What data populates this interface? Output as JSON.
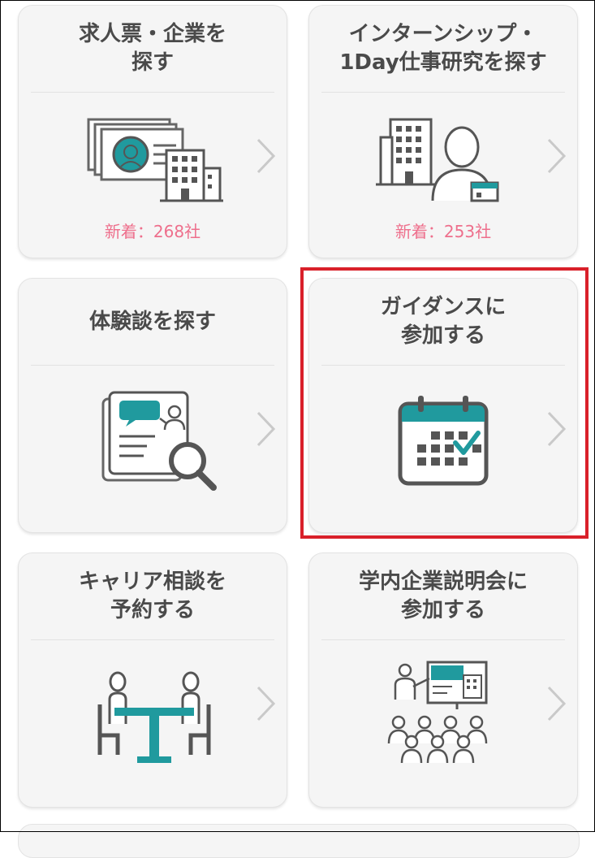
{
  "accent": "#209a9e",
  "highlight_color": "#d9202a",
  "new_count_color": "#ee6f8c",
  "cards": [
    {
      "title": "求人票・企業を\n探す",
      "icon": "company-search-icon",
      "new_count": "新着：268社"
    },
    {
      "title": "インターンシップ・\n1Day仕事研究を探す",
      "icon": "internship-icon",
      "new_count": "新着：253社"
    },
    {
      "title": "体験談を探す",
      "icon": "experience-search-icon"
    },
    {
      "title": "ガイダンスに\n参加する",
      "icon": "calendar-icon",
      "highlighted": true
    },
    {
      "title": "キャリア相談を\n予約する",
      "icon": "career-consultation-icon"
    },
    {
      "title": "学内企業説明会に\n参加する",
      "icon": "presentation-icon"
    }
  ]
}
